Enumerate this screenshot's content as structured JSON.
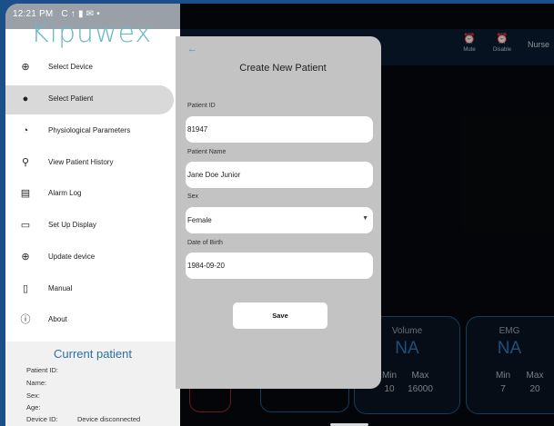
{
  "status_bar": {
    "time": "12:21 PM",
    "icons": "C ↑ ▮ ✉ •"
  },
  "header": {
    "mute_label": "Mute",
    "disable_label": "Disable",
    "user_label": "Nurse",
    "accent_color": "#e24b3b"
  },
  "background_panels": [
    {
      "title": "Volume",
      "value": "NA",
      "min_label": "Min",
      "max_label": "Max",
      "min_value": "10",
      "max_value": "16000"
    },
    {
      "title": "EMG",
      "value": "NA",
      "min_label": "Min",
      "max_label": "Max",
      "min_value": "7",
      "max_value": "20"
    }
  ],
  "drawer": {
    "logo": "Kipuwex",
    "items": [
      {
        "label": "Select Device",
        "icon": "add-circle-icon"
      },
      {
        "label": "Select Patient",
        "icon": "patient-icon"
      },
      {
        "label": "Physiological Parameters",
        "icon": "gauge-icon"
      },
      {
        "label": "View Patient History",
        "icon": "history-search-icon"
      },
      {
        "label": "Alarm Log",
        "icon": "log-icon"
      },
      {
        "label": "Set Up Display",
        "icon": "display-icon"
      },
      {
        "label": "Update device",
        "icon": "add-circle-icon"
      },
      {
        "label": "Manual",
        "icon": "book-icon"
      },
      {
        "label": "About",
        "icon": "info-icon"
      }
    ],
    "current_patient": {
      "title": "Current patient",
      "id_label": "Patient ID:",
      "name_label": "Name:",
      "sex_label": "Sex:",
      "age_label": "Age:",
      "device_label": "Device ID:",
      "device_value": "Device disconnected"
    }
  },
  "dialog": {
    "title": "Create New Patient",
    "patient_id_label": "Patient ID",
    "patient_id_value": "81947",
    "patient_name_label": "Patient Name",
    "patient_name_value": "Jane Doe Junior",
    "sex_label": "Sex",
    "sex_value": "Female",
    "dob_label": "Date of Birth",
    "dob_value": "1984-09-20",
    "save_label": "Save"
  }
}
